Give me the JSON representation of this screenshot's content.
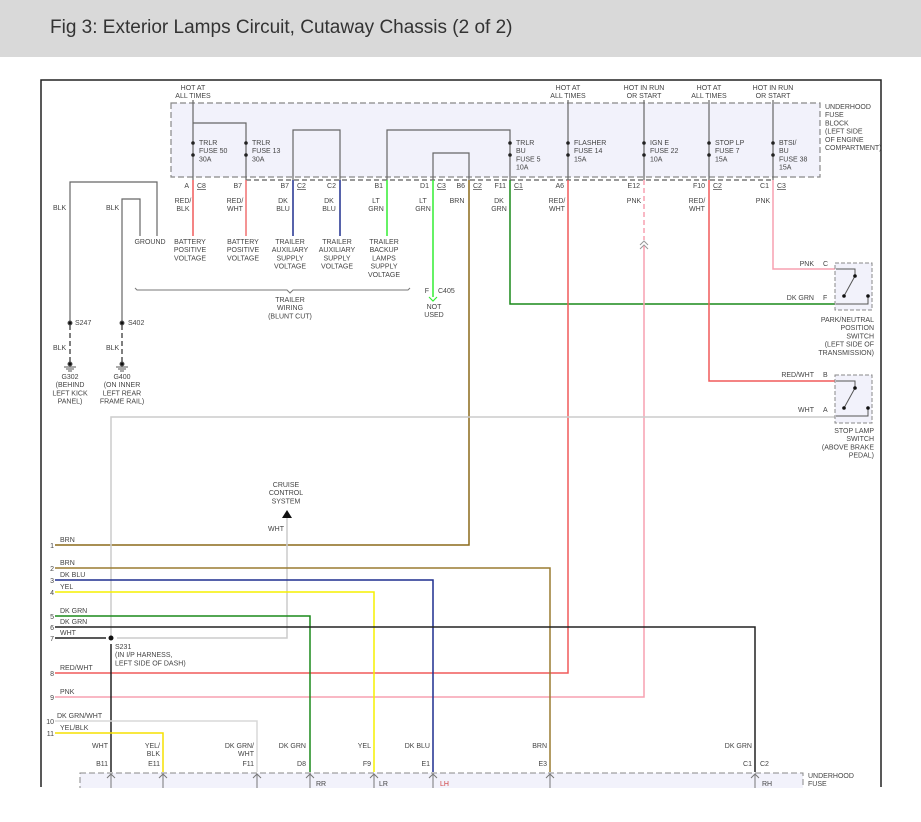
{
  "title": "Fig 3: Exterior Lamps Circuit, Cutaway Chassis (2 of 2)",
  "colors": {
    "red": "#f05a5a",
    "pink": "#f7a0b0",
    "dk_blu": "#1f2f8f",
    "lt_grn": "#33ee33",
    "dk_grn": "#1a8a1a",
    "brn": "#8b6a1a",
    "yel": "#f5f000",
    "wht": "#cccccc",
    "blk": "#222222",
    "fuse_block_fill": "#f2f2fb"
  },
  "power": {
    "p1": "HOT AT\nALL TIMES",
    "p2": "HOT AT\nALL TIMES",
    "p3": "HOT IN RUN\nOR START",
    "p4": "HOT AT\nALL TIMES",
    "p5": "HOT IN RUN\nOR START"
  },
  "fuses": {
    "f1": "TRLR\nFUSE 50\n30A",
    "f2": "TRLR\nFUSE 13\n30A",
    "f3": "TRLR\nBU\nFUSE 5\n10A",
    "f4": "FLASHER\nFUSE 14\n15A",
    "f5": "IGN E\nFUSE 22\n10A",
    "f6": "STOP LP\nFUSE 7\n15A",
    "f7": "BTSI/\nBU\nFUSE 38\n15A"
  },
  "fuse_block_label": "UNDERHOOD\nFUSE\nBLOCK\n(LEFT SIDE\nOF ENGINE\nCOMPARTMENT)",
  "pins": {
    "a": "A",
    "a_c": "C8",
    "b7": "B7",
    "b7b": "B7",
    "b7b_c": "C2",
    "c2": "C2",
    "b1": "B1",
    "d1": "D1",
    "d1_c": "C3",
    "b6": "B6",
    "b6_c": "C2",
    "f11": "F11",
    "f11_c": "C1",
    "a6": "A6",
    "e12": "E12",
    "f10": "F10",
    "f10_c": "C2",
    "c1": "C1",
    "c1_c": "C3"
  },
  "wire_colors": {
    "w1": "RED/\nBLK",
    "w2": "RED/\nWHT",
    "w3": "DK\nBLU",
    "w4": "DK\nBLU",
    "w5": "LT\nGRN",
    "w6": "LT\nGRN",
    "w7": "BRN",
    "w8": "DK\nGRN",
    "w9": "RED/\nWHT",
    "w10": "PNK",
    "w11": "RED/\nWHT",
    "w12": "PNK"
  },
  "functions": {
    "ground": "GROUND",
    "bpv1": "BATTERY\nPOSITIVE\nVOLTAGE",
    "bpv2": "BATTERY\nPOSITIVE\nVOLTAGE",
    "tasv1": "TRAILER\nAUXILIARY\nSUPPLY\nVOLTAGE",
    "tasv2": "TRAILER\nAUXILIARY\nSUPPLY\nVOLTAGE",
    "tbl": "TRAILER\nBACKUP\nLAMPS\nSUPPLY\nVOLTAGE",
    "trailer_wiring": "TRAILER\nWIRING\n(BLUNT CUT)"
  },
  "c405": {
    "pin": "F",
    "conn": "C405",
    "note": "NOT\nUSED"
  },
  "grounds": {
    "blk1": "BLK",
    "blk2": "BLK",
    "s247": "S247",
    "s402": "S402",
    "blk3": "BLK",
    "blk4": "BLK",
    "g302": "G302\n(BEHIND\nLEFT KICK\nPANEL)",
    "g400": "G400\n(ON INNER\nLEFT REAR\nFRAME RAIL)"
  },
  "switches": {
    "pnp": {
      "wire_c": "PNK",
      "pin_c": "C",
      "wire_f": "DK GRN",
      "pin_f": "F",
      "label": "PARK/NEUTRAL\nPOSITION\nSWITCH\n(LEFT SIDE OF\nTRANSMISSION)"
    },
    "stop": {
      "wire_b": "RED/WHT",
      "pin_b": "B",
      "wire_a": "WHT",
      "pin_a": "A",
      "label": "STOP LAMP\nSWITCH\n(ABOVE BRAKE\nPEDAL)"
    }
  },
  "cruise": {
    "label": "CRUISE\nCONTROL\nSYSTEM",
    "wire": "WHT"
  },
  "rows": [
    {
      "num": "1",
      "label": "BRN"
    },
    {
      "num": "2",
      "label": "BRN"
    },
    {
      "num": "3",
      "label": "DK BLU"
    },
    {
      "num": "4",
      "label": "YEL"
    },
    {
      "num": "5",
      "label": "DK GRN"
    },
    {
      "num": "6",
      "label": "DK GRN"
    },
    {
      "num": "7",
      "label": "WHT"
    },
    {
      "num": "8",
      "label": "RED/WHT"
    },
    {
      "num": "9",
      "label": "PNK"
    },
    {
      "num": "10",
      "label": "DK GRN/WHT"
    },
    {
      "num": "11",
      "label": "YEL/BLK"
    }
  ],
  "s231": "S231\n(IN I/P HARNESS,\nLEFT SIDE OF DASH)",
  "bottom": {
    "wires": [
      "WHT",
      "YEL/\nBLK",
      "DK GRN/\nWHT",
      "DK GRN",
      "YEL",
      "DK BLU",
      "BRN",
      "DK GRN"
    ],
    "pins": [
      "B11",
      "E11",
      "F11",
      "D8",
      "F9",
      "E1",
      "E3",
      "C1"
    ],
    "conn": "C2",
    "inner": [
      "RR",
      "LR",
      "LH",
      "RH"
    ],
    "block_label": "UNDERHOOD\nFUSE"
  }
}
